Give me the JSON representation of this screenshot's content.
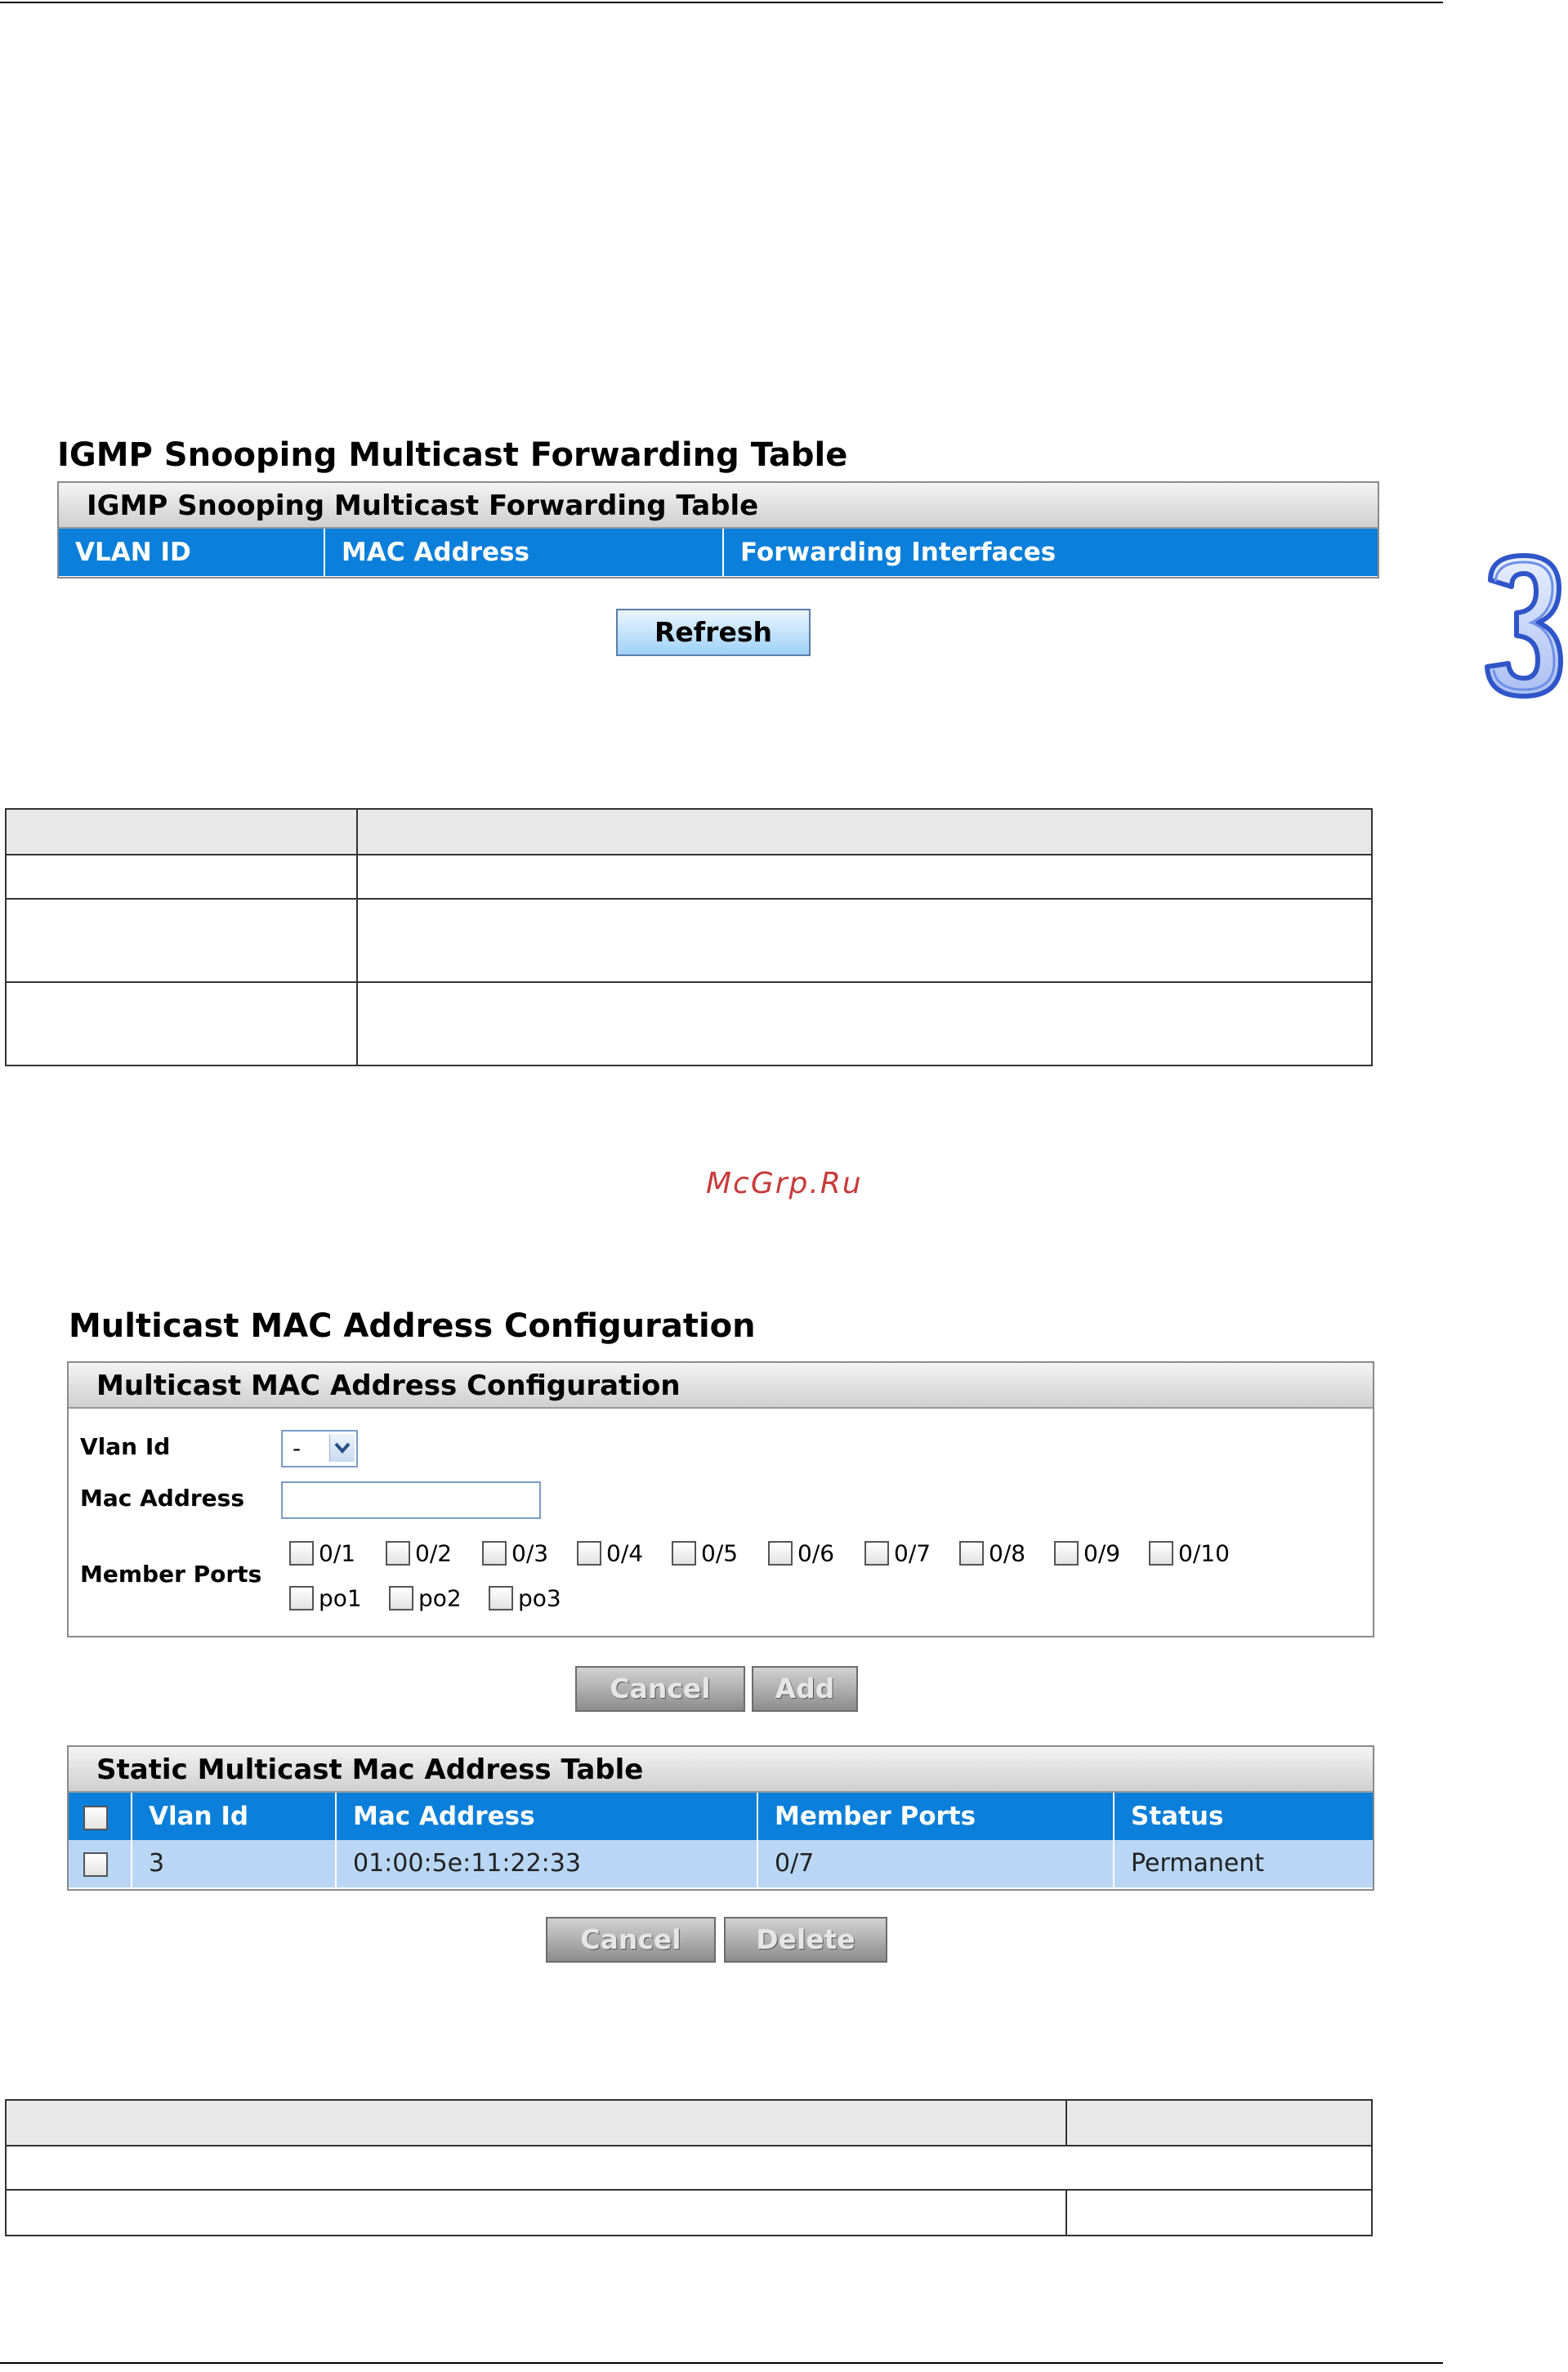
{
  "chapter_marker": "3",
  "watermark": "McGrp.Ru",
  "igmp": {
    "heading": "IGMP Snooping Multicast Forwarding Table",
    "panel_title": "IGMP Snooping Multicast Forwarding Table",
    "columns": [
      "VLAN ID",
      "MAC Address",
      "Forwarding Interfaces"
    ],
    "refresh_label": "Refresh"
  },
  "mcast": {
    "heading": "Multicast MAC Address Configuration",
    "panel_title": "Multicast MAC Address Configuration",
    "vlan_label": "Vlan Id",
    "vlan_value": "-",
    "mac_label": "Mac Address",
    "mac_value": "",
    "member_label": "Member Ports",
    "ports_row1": [
      "0/1",
      "0/2",
      "0/3",
      "0/4",
      "0/5",
      "0/6",
      "0/7",
      "0/8",
      "0/9",
      "0/10"
    ],
    "ports_row2": [
      "po1",
      "po2",
      "po3"
    ],
    "cancel_label": "Cancel",
    "add_label": "Add"
  },
  "static_table": {
    "title": "Static Multicast Mac Address Table",
    "columns": [
      "Vlan Id",
      "Mac Address",
      "Member Ports",
      "Status"
    ],
    "rows": [
      {
        "vlan": "3",
        "mac": "01:00:5e:11:22:33",
        "ports": "0/7",
        "status": "Permanent"
      }
    ],
    "cancel_label": "Cancel",
    "delete_label": "Delete"
  },
  "colors": {
    "header_blue": "#0b7fd9",
    "row_blue": "#b9d6f5",
    "marker_blue": "#3b63d9"
  }
}
